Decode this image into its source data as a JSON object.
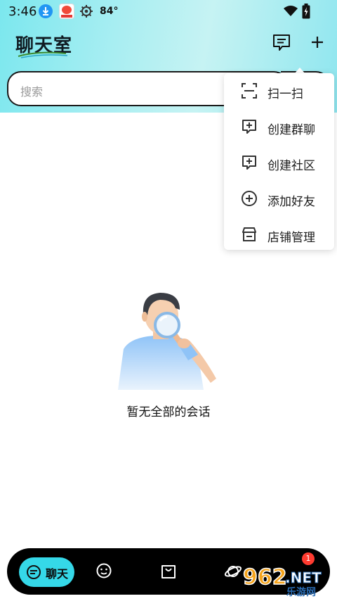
{
  "status_bar": {
    "time": "3:46",
    "temperature": "84°"
  },
  "header": {
    "title": "聊天室"
  },
  "search": {
    "placeholder": "搜索"
  },
  "menu": {
    "items": [
      {
        "label": "扫一扫",
        "icon": "scan-icon"
      },
      {
        "label": "创建群聊",
        "icon": "chat-plus-icon"
      },
      {
        "label": "创建社区",
        "icon": "chat-plus-icon"
      },
      {
        "label": "添加好友",
        "icon": "add-circle-icon"
      },
      {
        "label": "店铺管理",
        "icon": "store-icon"
      }
    ]
  },
  "empty_state": {
    "message": "暂无全部的会话"
  },
  "bottom_nav": {
    "chat_label": "聊天",
    "badge_count": "1"
  },
  "watermark": {
    "brand": "962",
    "suffix": ".NET",
    "sub": "乐游网"
  },
  "colors": {
    "accent": "#35d8e8",
    "badge": "#ff3b30",
    "nav_bg": "#000000"
  }
}
